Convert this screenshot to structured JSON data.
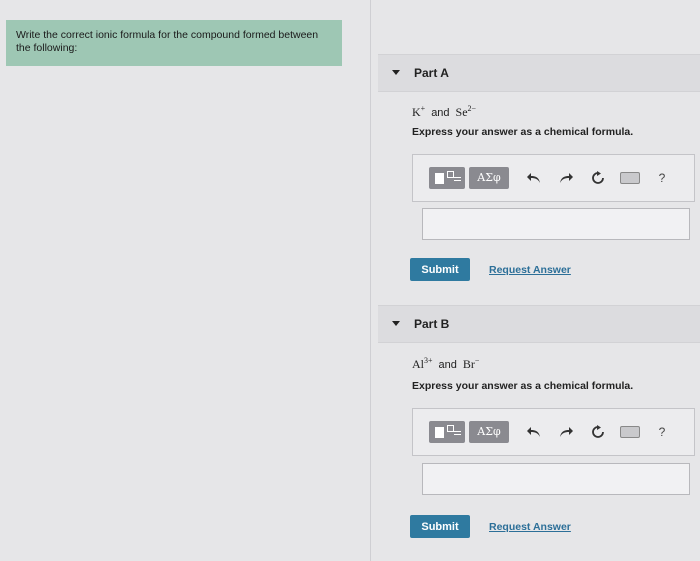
{
  "instructions": "Write the correct ionic formula for the compound formed between the following:",
  "parts": [
    {
      "title": "Part A",
      "ion1": {
        "symbol": "K",
        "charge": "+"
      },
      "and": "and",
      "ion2": {
        "symbol": "Se",
        "charge": "2−"
      },
      "prompt": "Express your answer as a chemical formula.",
      "toolbar": {
        "greek": "ΑΣφ",
        "help": "?"
      },
      "answer_value": "",
      "submit_label": "Submit",
      "request_label": "Request Answer"
    },
    {
      "title": "Part B",
      "ion1": {
        "symbol": "Al",
        "charge": "3+"
      },
      "and": "and",
      "ion2": {
        "symbol": "Br",
        "charge": "−"
      },
      "prompt": "Express your answer as a chemical formula.",
      "toolbar": {
        "greek": "ΑΣφ",
        "help": "?"
      },
      "answer_value": "",
      "submit_label": "Submit",
      "request_label": "Request Answer"
    }
  ],
  "icons": [
    "caret-down-icon",
    "template-icon",
    "undo-icon",
    "redo-icon",
    "reset-icon",
    "keyboard-icon",
    "help-icon"
  ]
}
